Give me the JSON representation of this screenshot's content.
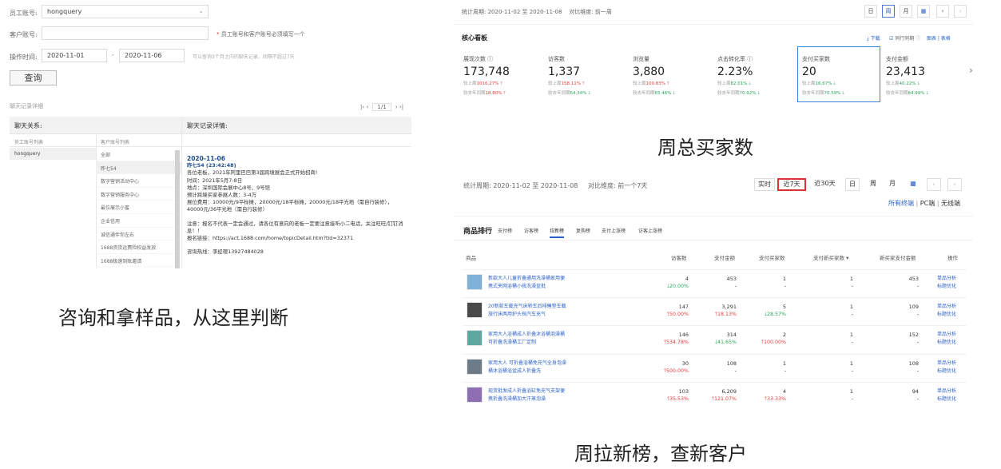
{
  "chat": {
    "labels": {
      "staff": "员工账号:",
      "customer": "客户账号:",
      "time": "操作时间:"
    },
    "staff_value": "hongquery",
    "customer_value": "",
    "required_note_star": "*",
    "required_note": "员工账号和客户账号必须填写一个",
    "time_from": "2020-11-01",
    "time_dash": "-",
    "time_to": "2020-11-06",
    "time_note": "可以查询3个月之内的聊天记录，间隔不超过7天",
    "query_button": "查询",
    "record_section": "聊天记录详细",
    "pager": {
      "prev": "|‹  ‹",
      "page": "1/1",
      "next": "›  ›|"
    },
    "head_left": "聊天关系:",
    "head_right": "聊天记录详情:",
    "col_staff": "员工账号列表",
    "col_account": "客户账号列表",
    "staff_rows": [
      "hongquery"
    ],
    "accounts": [
      "全部",
      "昨七54",
      "数字营销活动中心",
      "数字营销服务中心",
      "最位展示小蜜",
      "企业信用",
      "诚信通伴你左右",
      "1688资货运费险权益发放",
      "1688极速到账邀请"
    ],
    "detail": {
      "date": "2020-11-06",
      "who": "昨七54 (23:42:48)",
      "body": "各位老板，2021年阿里巴巴第3届跨境展会正式开始招商!\n时间：2021年5月7-8日\n地点：深圳国际会展中心8号、9号馆\n预计跨境买家参展人数：3-4万\n展位费用：10000元/9平标摊，20000元/18平标摊，20000元/18平光地（需自行装修），\n40000元/36平光地（需自行装修）",
      "body2": "注意：报名不代表一定会通过，请各位有意向的老板一定要注意接听小二电话，关注旺旺/钉钉消\n息！！\n报名链接：https://act.1688.com/home/topicDetail.htm?tid=32371",
      "body3": "咨询热线：李经理13927484028"
    }
  },
  "captions": {
    "left": "咨询和拿样品，从这里判断",
    "top_right": "周总买家数",
    "bottom_right": "周拉新榜，查新客户"
  },
  "core": {
    "period_label": "统计周期:",
    "period": "2020-11-02 至 2020-11-08",
    "compare_label": "对比维度:",
    "compare": "前一周",
    "buttons": [
      "日",
      "周",
      "月"
    ],
    "title": "核心看板",
    "download": "下载",
    "yoy": "同行同期",
    "view": "图表 | 表格",
    "metrics": [
      {
        "label": "展现次数 ⓘ",
        "value": "173,748",
        "wow_label": "较上周",
        "wow": "1016.27%",
        "wow_dir": "up",
        "yoy_label": "较去年同期",
        "yoy": "18.80%",
        "yoy_dir": "up"
      },
      {
        "label": "访客数",
        "value": "1,337",
        "wow_label": "较上周",
        "wow": "158.11%",
        "wow_dir": "up",
        "yoy_label": "较去年同期",
        "yoy": "64.34%",
        "yoy_dir": "down"
      },
      {
        "label": "浏览量",
        "value": "3,880",
        "wow_label": "较上周",
        "wow": "100.83%",
        "wow_dir": "up",
        "yoy_label": "较去年同期",
        "yoy": "65.46%",
        "yoy_dir": "down"
      },
      {
        "label": "点击转化率 ⓘ",
        "value": "2.23%",
        "wow_label": "较上周",
        "wow": "82.01%",
        "wow_dir": "down",
        "yoy_label": "较去年同期",
        "yoy": "70.92%",
        "yoy_dir": "down"
      },
      {
        "label": "支付买家数",
        "value": "20",
        "wow_label": "较上周",
        "wow": "16.67%",
        "wow_dir": "down",
        "yoy_label": "较去年同期",
        "yoy": "70.59%",
        "yoy_dir": "down"
      },
      {
        "label": "支付金额",
        "value": "23,413",
        "wow_label": "较上周",
        "wow": "40.22%",
        "wow_dir": "down",
        "yoy_label": "较去年同期",
        "yoy": "84.99%",
        "yoy_dir": "down"
      }
    ]
  },
  "ranking": {
    "period_label": "统计周期:",
    "period": "2020-11-02 至 2020-11-08",
    "compare_label": "对比维度:",
    "compare": "前一个7天",
    "buttons": [
      "实时",
      "近7天",
      "近30天",
      "日",
      "周",
      "月"
    ],
    "links": [
      "所有终端",
      "PC端",
      "无线端"
    ],
    "title": "商品排行",
    "tabs": [
      "支付榜",
      "访客榜",
      "拉新榜",
      "复购榜",
      "支付上涨榜",
      "访客上涨榜"
    ],
    "headers": [
      "商品",
      "访客数",
      "支付金额",
      "支付买家数",
      "支付新买家数 ▾",
      "新买家支付金额",
      "操作"
    ],
    "ops": [
      "单品分析",
      "标题优化"
    ],
    "rows": [
      {
        "name": "新款大人儿童折叠通用洗澡桶家用便携式夹网浴桶小孩洗澡盆批",
        "visitors": "4",
        "visitors_chg": "20.00%",
        "visitors_dir": "down",
        "pay": "453",
        "pay_chg": "-",
        "pay_dir": "",
        "buyers": "1",
        "buyers_chg": "-",
        "buyers_dir": "",
        "new_buyers": "1",
        "new_buyers_chg": "-",
        "new_pay": "453",
        "new_pay_chg": "-",
        "color": "#7fb2d9"
      },
      {
        "name": "20新款车载充气床轿车后排睡垫车载旅行床两用护头挡汽车充气",
        "visitors": "147",
        "visitors_chg": "50.00%",
        "visitors_dir": "up",
        "pay": "3,291",
        "pay_chg": "18.13%",
        "pay_dir": "up",
        "buyers": "5",
        "buyers_chg": "28.57%",
        "buyers_dir": "down",
        "new_buyers": "1",
        "new_buyers_chg": "-",
        "new_pay": "109",
        "new_pay_chg": "-",
        "color": "#4a4a4a"
      },
      {
        "name": "家用大人浴桶成人折叠沐浴桶泡澡桶可折叠洗澡桶工厂定制",
        "visitors": "146",
        "visitors_chg": "534.78%",
        "visitors_dir": "up",
        "pay": "314",
        "pay_chg": "41.65%",
        "pay_dir": "down",
        "buyers": "2",
        "buyers_chg": "100.00%",
        "buyers_dir": "up",
        "new_buyers": "1",
        "new_buyers_chg": "-",
        "new_pay": "152",
        "new_pay_chg": "-",
        "color": "#5fa8a0"
      },
      {
        "name": "家用大人 可折叠浴桶免充气全身泡澡桶沐浴桶浴盆成人折叠洗",
        "visitors": "30",
        "visitors_chg": "500.00%",
        "visitors_dir": "up",
        "pay": "108",
        "pay_chg": "-",
        "pay_dir": "",
        "buyers": "1",
        "buyers_chg": "-",
        "buyers_dir": "",
        "new_buyers": "1",
        "new_buyers_chg": "-",
        "new_pay": "108",
        "new_pay_chg": "-",
        "color": "#6d7b86"
      },
      {
        "name": "现货批发成人折叠浴缸免充气支架便携折叠洗澡桶加大汗蒸泡澡",
        "visitors": "103",
        "visitors_chg": "35.53%",
        "visitors_dir": "up",
        "pay": "6,209",
        "pay_chg": "121.07%",
        "pay_dir": "up",
        "buyers": "4",
        "buyers_chg": "33.33%",
        "buyers_dir": "up",
        "new_buyers": "1",
        "new_buyers_chg": "-",
        "new_pay": "94",
        "new_pay_chg": "-",
        "color": "#8f6fb3"
      }
    ]
  }
}
